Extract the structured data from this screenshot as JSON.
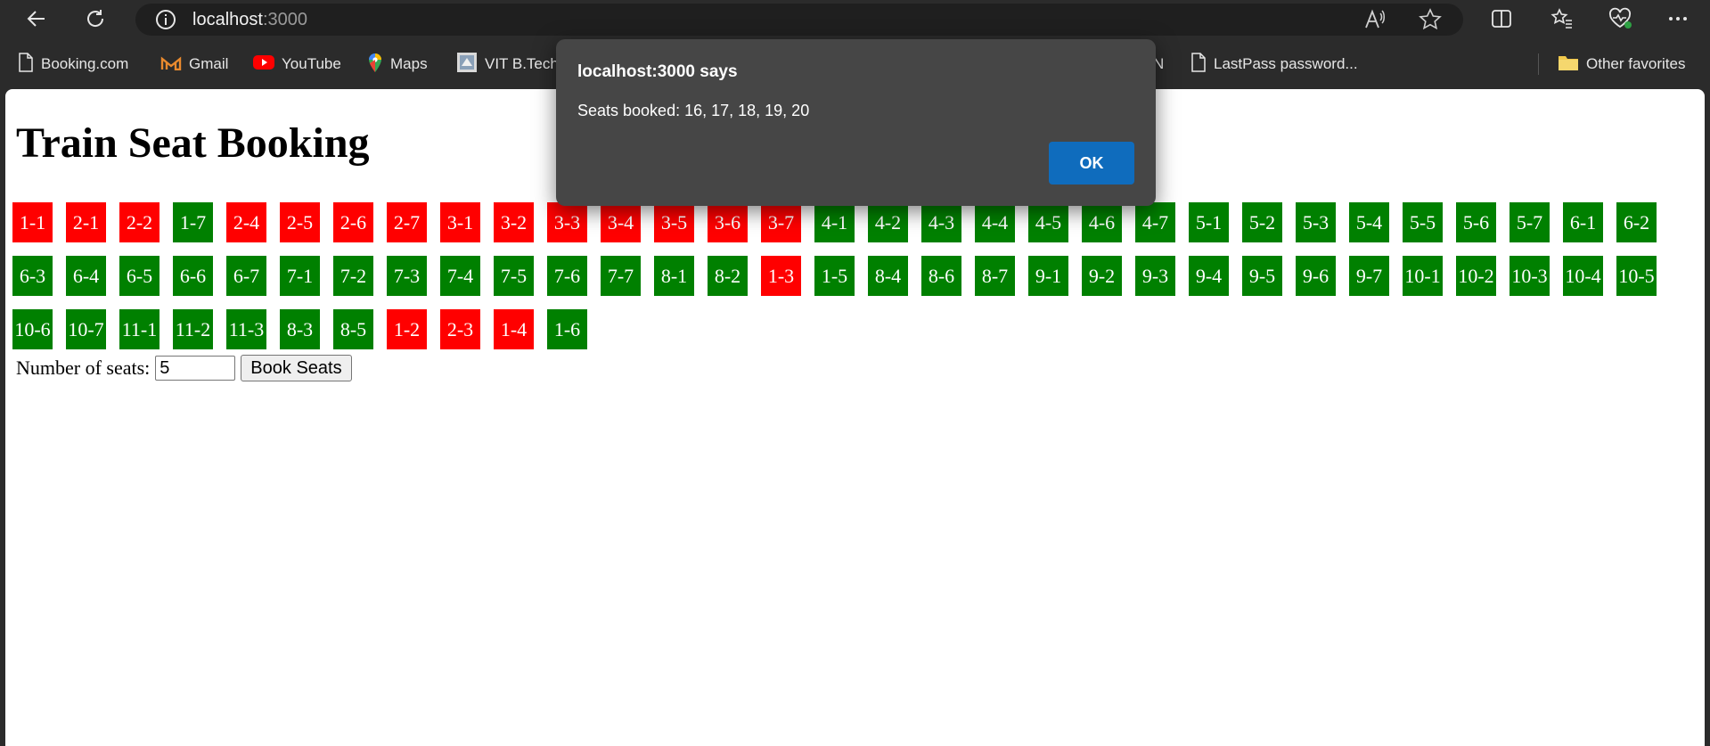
{
  "browser": {
    "url_host": "localhost",
    "url_port": ":3000"
  },
  "favorites": [
    {
      "label": "Booking.com",
      "icon": "page-icon"
    },
    {
      "label": "Gmail",
      "icon": "gmail-icon"
    },
    {
      "label": "YouTube",
      "icon": "youtube-icon"
    },
    {
      "label": "Maps",
      "icon": "maps-icon"
    },
    {
      "label": "VIT B.Tech",
      "icon": "vit-icon"
    },
    {
      "label": "N",
      "icon": ""
    },
    {
      "label": "LastPass password...",
      "icon": "page-icon"
    },
    {
      "label": "Other favorites",
      "icon": "folder-icon"
    }
  ],
  "page": {
    "title": "Train Seat Booking",
    "seats_label": "Number of seats:",
    "seats_value": "5",
    "book_button": "Book Seats"
  },
  "seats": [
    {
      "label": "1-1",
      "booked": true
    },
    {
      "label": "2-1",
      "booked": true
    },
    {
      "label": "2-2",
      "booked": true
    },
    {
      "label": "1-7",
      "booked": false
    },
    {
      "label": "2-4",
      "booked": true
    },
    {
      "label": "2-5",
      "booked": true
    },
    {
      "label": "2-6",
      "booked": true
    },
    {
      "label": "2-7",
      "booked": true
    },
    {
      "label": "3-1",
      "booked": true
    },
    {
      "label": "3-2",
      "booked": true
    },
    {
      "label": "3-3",
      "booked": true
    },
    {
      "label": "3-4",
      "booked": true
    },
    {
      "label": "3-5",
      "booked": true
    },
    {
      "label": "3-6",
      "booked": true
    },
    {
      "label": "3-7",
      "booked": true
    },
    {
      "label": "4-1",
      "booked": false
    },
    {
      "label": "4-2",
      "booked": false
    },
    {
      "label": "4-3",
      "booked": false
    },
    {
      "label": "4-4",
      "booked": false
    },
    {
      "label": "4-5",
      "booked": false
    },
    {
      "label": "4-6",
      "booked": false
    },
    {
      "label": "4-7",
      "booked": false
    },
    {
      "label": "5-1",
      "booked": false
    },
    {
      "label": "5-2",
      "booked": false
    },
    {
      "label": "5-3",
      "booked": false
    },
    {
      "label": "5-4",
      "booked": false
    },
    {
      "label": "5-5",
      "booked": false
    },
    {
      "label": "5-6",
      "booked": false
    },
    {
      "label": "5-7",
      "booked": false
    },
    {
      "label": "6-1",
      "booked": false
    },
    {
      "label": "6-2",
      "booked": false
    },
    {
      "label": "6-3",
      "booked": false
    },
    {
      "label": "6-4",
      "booked": false
    },
    {
      "label": "6-5",
      "booked": false
    },
    {
      "label": "6-6",
      "booked": false
    },
    {
      "label": "6-7",
      "booked": false
    },
    {
      "label": "7-1",
      "booked": false
    },
    {
      "label": "7-2",
      "booked": false
    },
    {
      "label": "7-3",
      "booked": false
    },
    {
      "label": "7-4",
      "booked": false
    },
    {
      "label": "7-5",
      "booked": false
    },
    {
      "label": "7-6",
      "booked": false
    },
    {
      "label": "7-7",
      "booked": false
    },
    {
      "label": "8-1",
      "booked": false
    },
    {
      "label": "8-2",
      "booked": false
    },
    {
      "label": "1-3",
      "booked": true
    },
    {
      "label": "1-5",
      "booked": false
    },
    {
      "label": "8-4",
      "booked": false
    },
    {
      "label": "8-6",
      "booked": false
    },
    {
      "label": "8-7",
      "booked": false
    },
    {
      "label": "9-1",
      "booked": false
    },
    {
      "label": "9-2",
      "booked": false
    },
    {
      "label": "9-3",
      "booked": false
    },
    {
      "label": "9-4",
      "booked": false
    },
    {
      "label": "9-5",
      "booked": false
    },
    {
      "label": "9-6",
      "booked": false
    },
    {
      "label": "9-7",
      "booked": false
    },
    {
      "label": "10-1",
      "booked": false
    },
    {
      "label": "10-2",
      "booked": false
    },
    {
      "label": "10-3",
      "booked": false
    },
    {
      "label": "10-4",
      "booked": false
    },
    {
      "label": "10-5",
      "booked": false
    },
    {
      "label": "10-6",
      "booked": false
    },
    {
      "label": "10-7",
      "booked": false
    },
    {
      "label": "11-1",
      "booked": false
    },
    {
      "label": "11-2",
      "booked": false
    },
    {
      "label": "11-3",
      "booked": false
    },
    {
      "label": "8-3",
      "booked": false
    },
    {
      "label": "8-5",
      "booked": false
    },
    {
      "label": "1-2",
      "booked": true
    },
    {
      "label": "2-3",
      "booked": true
    },
    {
      "label": "1-4",
      "booked": true
    },
    {
      "label": "1-6",
      "booked": false
    }
  ],
  "dialog": {
    "title": "localhost:3000 says",
    "message": "Seats booked: 16, 17, 18, 19, 20",
    "ok_label": "OK"
  },
  "colors": {
    "available": "#008000",
    "booked": "#ff0000",
    "dialog_ok": "#0f6cbd"
  }
}
